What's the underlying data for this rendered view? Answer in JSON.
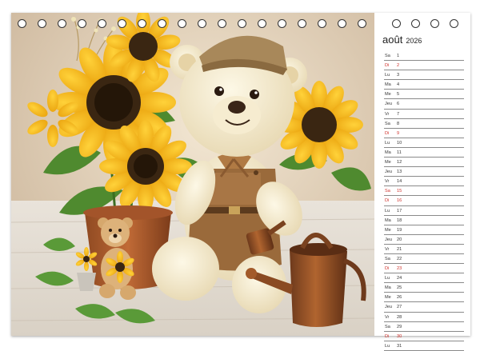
{
  "calendar": {
    "month": "août",
    "year": "2026",
    "accent_color": "#d0302a",
    "days": [
      {
        "name": "Sa",
        "num": "1",
        "red": false
      },
      {
        "name": "Di",
        "num": "2",
        "red": true
      },
      {
        "name": "Lu",
        "num": "3",
        "red": false
      },
      {
        "name": "Ma",
        "num": "4",
        "red": false
      },
      {
        "name": "Me",
        "num": "5",
        "red": false
      },
      {
        "name": "Jeu",
        "num": "6",
        "red": false
      },
      {
        "name": "Vr",
        "num": "7",
        "red": false
      },
      {
        "name": "Sa",
        "num": "8",
        "red": false
      },
      {
        "name": "Di",
        "num": "9",
        "red": true
      },
      {
        "name": "Lu",
        "num": "10",
        "red": false
      },
      {
        "name": "Ma",
        "num": "11",
        "red": false
      },
      {
        "name": "Me",
        "num": "12",
        "red": false
      },
      {
        "name": "Jeu",
        "num": "13",
        "red": false
      },
      {
        "name": "Vr",
        "num": "14",
        "red": false
      },
      {
        "name": "Sa",
        "num": "15",
        "red": true
      },
      {
        "name": "Di",
        "num": "16",
        "red": true
      },
      {
        "name": "Lu",
        "num": "17",
        "red": false
      },
      {
        "name": "Ma",
        "num": "18",
        "red": false
      },
      {
        "name": "Me",
        "num": "19",
        "red": false
      },
      {
        "name": "Jeu",
        "num": "20",
        "red": false
      },
      {
        "name": "Vr",
        "num": "21",
        "red": false
      },
      {
        "name": "Sa",
        "num": "22",
        "red": false
      },
      {
        "name": "Di",
        "num": "23",
        "red": true
      },
      {
        "name": "Lu",
        "num": "24",
        "red": false
      },
      {
        "name": "Ma",
        "num": "25",
        "red": false
      },
      {
        "name": "Me",
        "num": "26",
        "red": false
      },
      {
        "name": "Jeu",
        "num": "27",
        "red": false
      },
      {
        "name": "Vr",
        "num": "28",
        "red": false
      },
      {
        "name": "Sa",
        "num": "29",
        "red": false
      },
      {
        "name": "Di",
        "num": "30",
        "red": true
      },
      {
        "name": "Lu",
        "num": "31",
        "red": false
      }
    ]
  },
  "photo": {
    "subject": "teddy-bear-with-sunflowers"
  }
}
